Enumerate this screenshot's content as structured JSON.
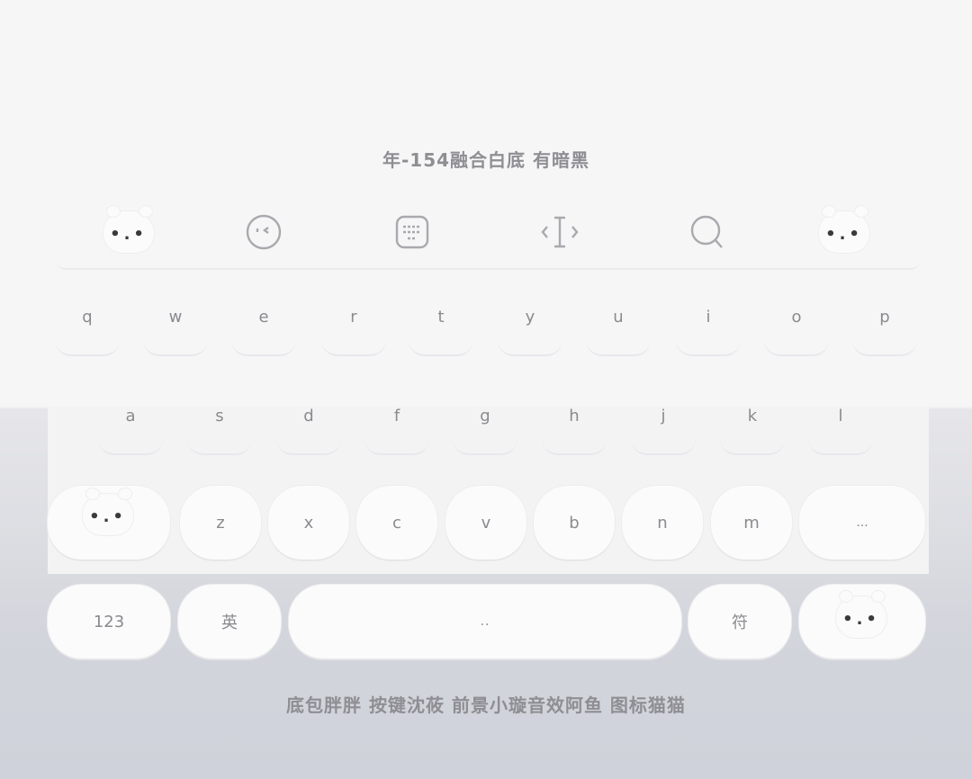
{
  "header": {
    "title": "年-154融合白底 有暗黑"
  },
  "toolbar": {
    "items": [
      {
        "icon": "bear-face-icon"
      },
      {
        "icon": "emoji-face-icon"
      },
      {
        "icon": "keyboard-icon"
      },
      {
        "icon": "cursor-move-icon"
      },
      {
        "icon": "search-icon"
      },
      {
        "icon": "bear-face-icon"
      }
    ],
    "bear_eyes": "•.•"
  },
  "rows": {
    "row1": [
      "q",
      "w",
      "e",
      "r",
      "t",
      "y",
      "u",
      "i",
      "o",
      "p"
    ],
    "row2": [
      "a",
      "s",
      "d",
      "f",
      "g",
      "h",
      "j",
      "k",
      "l"
    ],
    "row3": [
      "z",
      "x",
      "c",
      "v",
      "b",
      "n",
      "m"
    ]
  },
  "keys": {
    "shift_eyes": "•.•",
    "delete_label": "...",
    "num_label": "123",
    "lang_label": "英",
    "space_label": "..",
    "symbol_label": "符",
    "enter_eyes": "•.•"
  },
  "footer": {
    "credits": "底包胖胖  按键沈莜  前景小璇音效阿鱼  图标猫猫"
  }
}
